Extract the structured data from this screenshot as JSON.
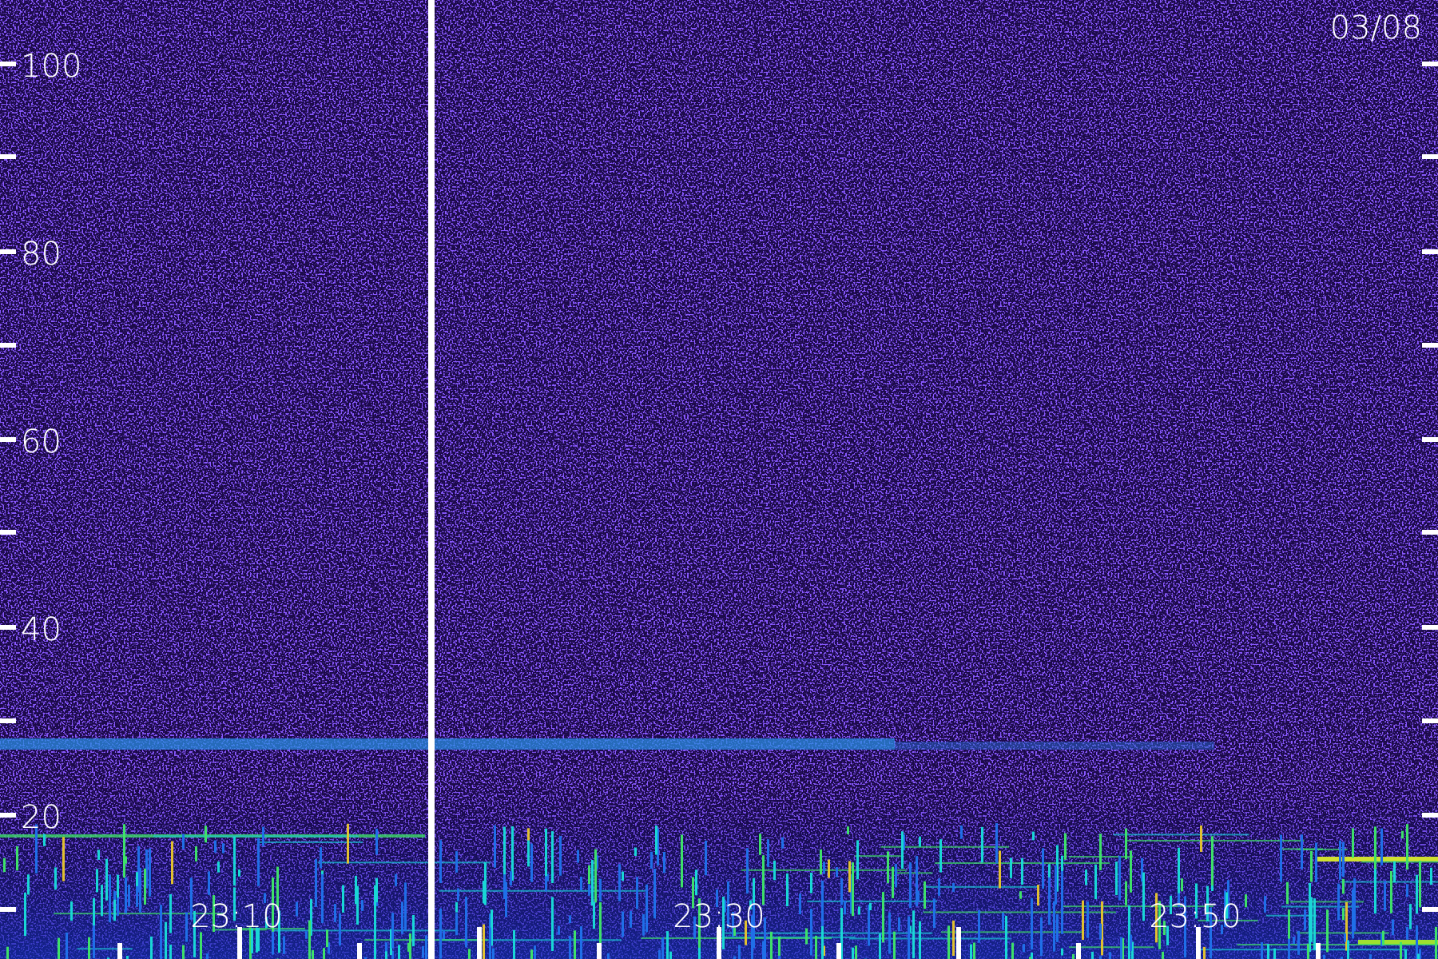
{
  "date": "03/08",
  "y_labels": [
    "100",
    "80",
    "60",
    "40",
    "20"
  ],
  "time_labels": [
    "23:10",
    "23:30",
    "23:50"
  ]
}
